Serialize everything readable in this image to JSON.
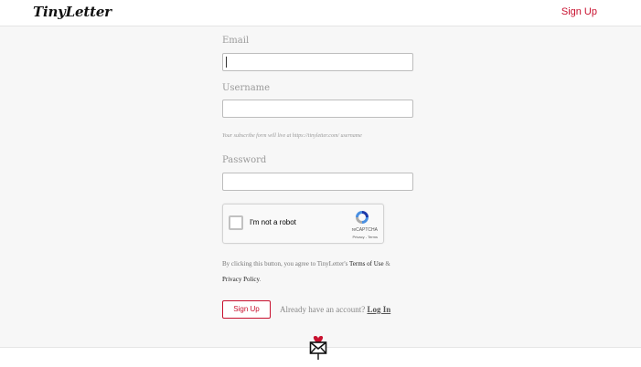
{
  "header": {
    "logo": "TinyLetter",
    "signup_link": "Sign Up"
  },
  "form": {
    "email_label": "Email",
    "email_value": "",
    "username_label": "Username",
    "username_value": "",
    "username_hint": "Your subscribe form will live at https://tinyletter.com/ username",
    "password_label": "Password",
    "password_value": ""
  },
  "captcha": {
    "checkbox_text": "I'm not a robot",
    "brand": "reCAPTCHA",
    "links": "Privacy - Terms"
  },
  "terms": {
    "prefix": "By clicking this button, you agree to TinyLetter's ",
    "terms_link": "Terms of Use",
    "and": " &",
    "privacy_link": "Privacy Policy",
    "suffix": "."
  },
  "actions": {
    "signup_button": "Sign Up",
    "already_text": "Already have an account?",
    "login_link": "Log In"
  },
  "colors": {
    "accent": "#c8102e",
    "background": "#f7f7f7"
  },
  "footer": {
    "icon": "envelope-heart-icon"
  }
}
